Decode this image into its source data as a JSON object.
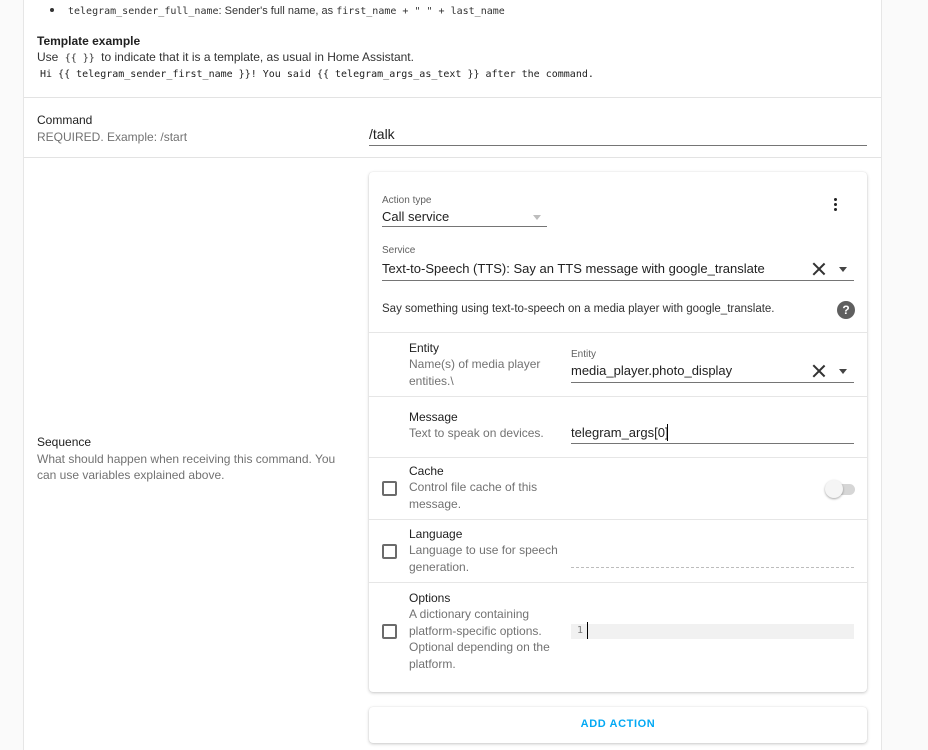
{
  "variables": {
    "var_name": "telegram_sender_full_name",
    "var_desc": ": Sender's full name, as ",
    "var_expr_a": "first_name",
    "var_expr_b": " + \" \" + ",
    "var_expr_c": "last_name"
  },
  "template": {
    "title": "Template example",
    "desc_before": "Use ",
    "desc_code": "{{ }}",
    "desc_after": " to indicate that it is a template, as usual in Home Assistant.",
    "example": "Hi {{ telegram_sender_first_name }}! You said {{ telegram_args_as_text }} after the command."
  },
  "command": {
    "title": "Command",
    "desc": "REQUIRED. Example: /start",
    "value": "/talk"
  },
  "sequence": {
    "title": "Sequence",
    "desc": "What should happen when receiving this command. You can use variables explained above."
  },
  "action": {
    "action_type_label": "Action type",
    "action_type_value": "Call service",
    "service_label": "Service",
    "service_value": "Text-to-Speech (TTS): Say an TTS message with google_translate",
    "service_help": "Say something using text-to-speech on a media player with google_translate.",
    "help_glyph": "?",
    "fields": {
      "entity": {
        "title": "Entity",
        "desc": "Name(s) of media player entities.\\",
        "input_label": "Entity",
        "value": "media_player.photo_display"
      },
      "message": {
        "title": "Message",
        "desc": "Text to speak on devices.",
        "value": "telegram_args[0]"
      },
      "cache": {
        "title": "Cache",
        "desc": "Control file cache of this message.",
        "enabled": false
      },
      "language": {
        "title": "Language",
        "desc": "Language to use for speech generation.",
        "enabled": false
      },
      "options": {
        "title": "Options",
        "desc": "A dictionary containing platform-specific options. Optional depending on the platform.",
        "enabled": false,
        "line_number": "1"
      }
    }
  },
  "add_action": {
    "label": "ADD ACTION"
  },
  "colors": {
    "accent": "#03a9f4",
    "text": "#212121",
    "secondary_text": "#727272"
  },
  "icons": {
    "menu": "kebab-menu-icon",
    "clear": "close-icon",
    "dropdown": "chevron-down-icon",
    "help": "help-circle-icon"
  }
}
